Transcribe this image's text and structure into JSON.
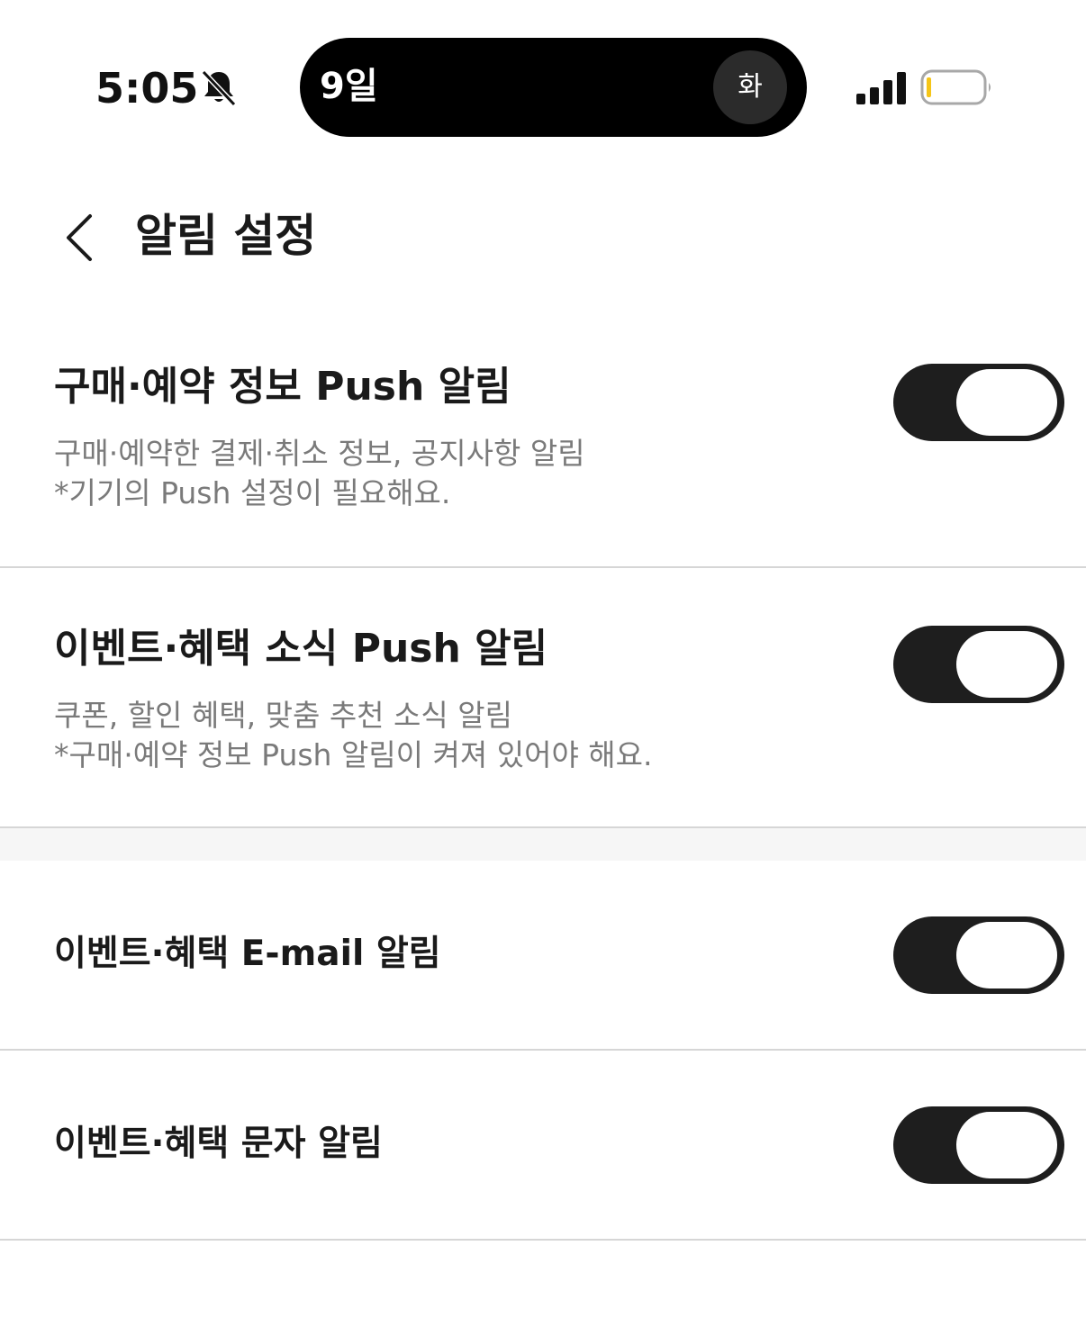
{
  "status_bar": {
    "time": "5:05",
    "island_date": "9일",
    "island_day": "화",
    "icons": [
      "bell-off-icon",
      "signal-icon",
      "battery-icon"
    ],
    "battery_color": "#f5c518"
  },
  "header": {
    "title": "알림 설정",
    "back_icon": "chevron-left-icon"
  },
  "settings": [
    {
      "title": "구매·예약 정보 Push 알림",
      "description": [
        "구매·예약한 결제·취소 정보, 공지사항 알림",
        "*기기의 Push 설정이 필요해요."
      ],
      "enabled": false
    },
    {
      "title": "이벤트·혜택 소식 Push 알림",
      "description": [
        "쿠폰, 할인 혜택, 맞춤 추천 소식 알림",
        "*구매·예약 정보 Push 알림이 켜져 있어야 해요."
      ],
      "enabled": false
    },
    {
      "title": "이벤트·혜택 E-mail 알림",
      "description": [],
      "enabled": false
    },
    {
      "title": "이벤트·혜택 문자 알림",
      "description": [],
      "enabled": false
    }
  ],
  "colors": {
    "toggle_track": "#1e1e1e",
    "toggle_knob": "#ffffff",
    "divider": "#d6d6d6",
    "description_text": "#7a7a7a"
  }
}
